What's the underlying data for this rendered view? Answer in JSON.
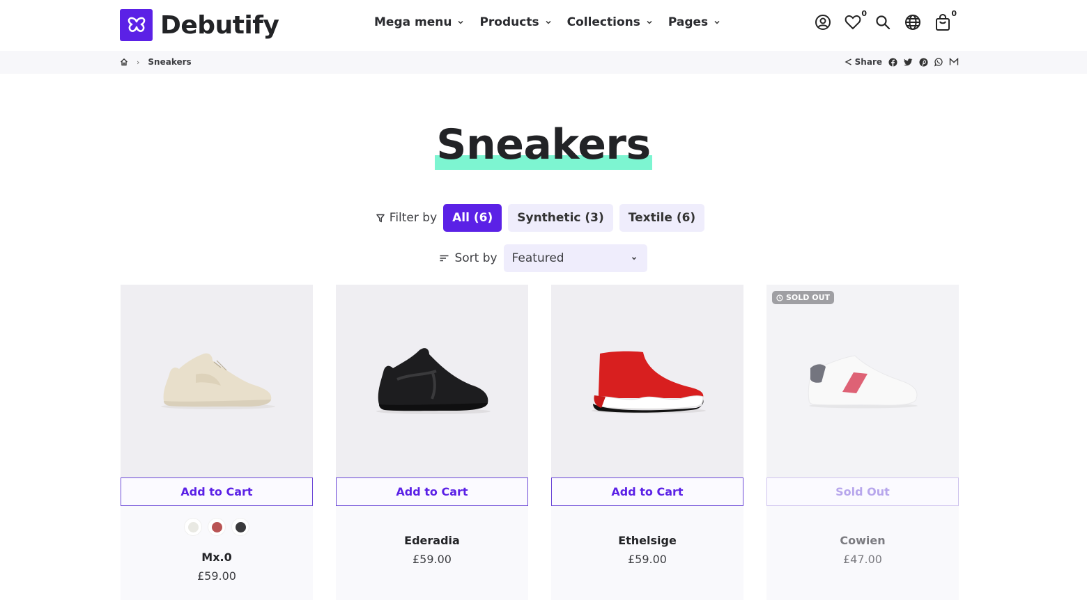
{
  "header": {
    "brand": "Debutify",
    "nav": [
      {
        "label": "Mega menu"
      },
      {
        "label": "Products"
      },
      {
        "label": "Collections"
      },
      {
        "label": "Pages"
      }
    ],
    "icons": {
      "account": "account-icon",
      "wishlist": "heart-icon",
      "wishlist_count": "0",
      "search": "search-icon",
      "language": "globe-icon",
      "cart": "shopping-bag-icon",
      "cart_count": "0"
    }
  },
  "breadcrumb": {
    "home_icon": "home-icon",
    "current": "Sneakers"
  },
  "share": {
    "label": "Share",
    "networks": [
      "facebook",
      "twitter",
      "pinterest",
      "whatsapp",
      "email"
    ]
  },
  "page": {
    "title": "Sneakers",
    "highlight_color": "#7df5d1",
    "accent_color": "#5b21e6"
  },
  "filter": {
    "label": "Filter by",
    "chips": [
      {
        "label": "All (6)",
        "active": true
      },
      {
        "label": "Synthetic (3)",
        "active": false
      },
      {
        "label": "Textile (6)",
        "active": false
      }
    ]
  },
  "sort": {
    "label": "Sort by",
    "selected": "Featured"
  },
  "products": [
    {
      "name": "Mx.0",
      "price": "£59.00",
      "button": "Add to Cart",
      "sold_out": false,
      "swatches": [
        "#e9e9e3",
        "#b95454",
        "#3a3a3c"
      ]
    },
    {
      "name": "Ederadia",
      "price": "£59.00",
      "button": "Add to Cart",
      "sold_out": false
    },
    {
      "name": "Ethelsige",
      "price": "£59.00",
      "button": "Add to Cart",
      "sold_out": false
    },
    {
      "name": "Cowien",
      "price": "£47.00",
      "button": "Sold Out",
      "sold_out": true,
      "badge": "SOLD OUT"
    }
  ]
}
